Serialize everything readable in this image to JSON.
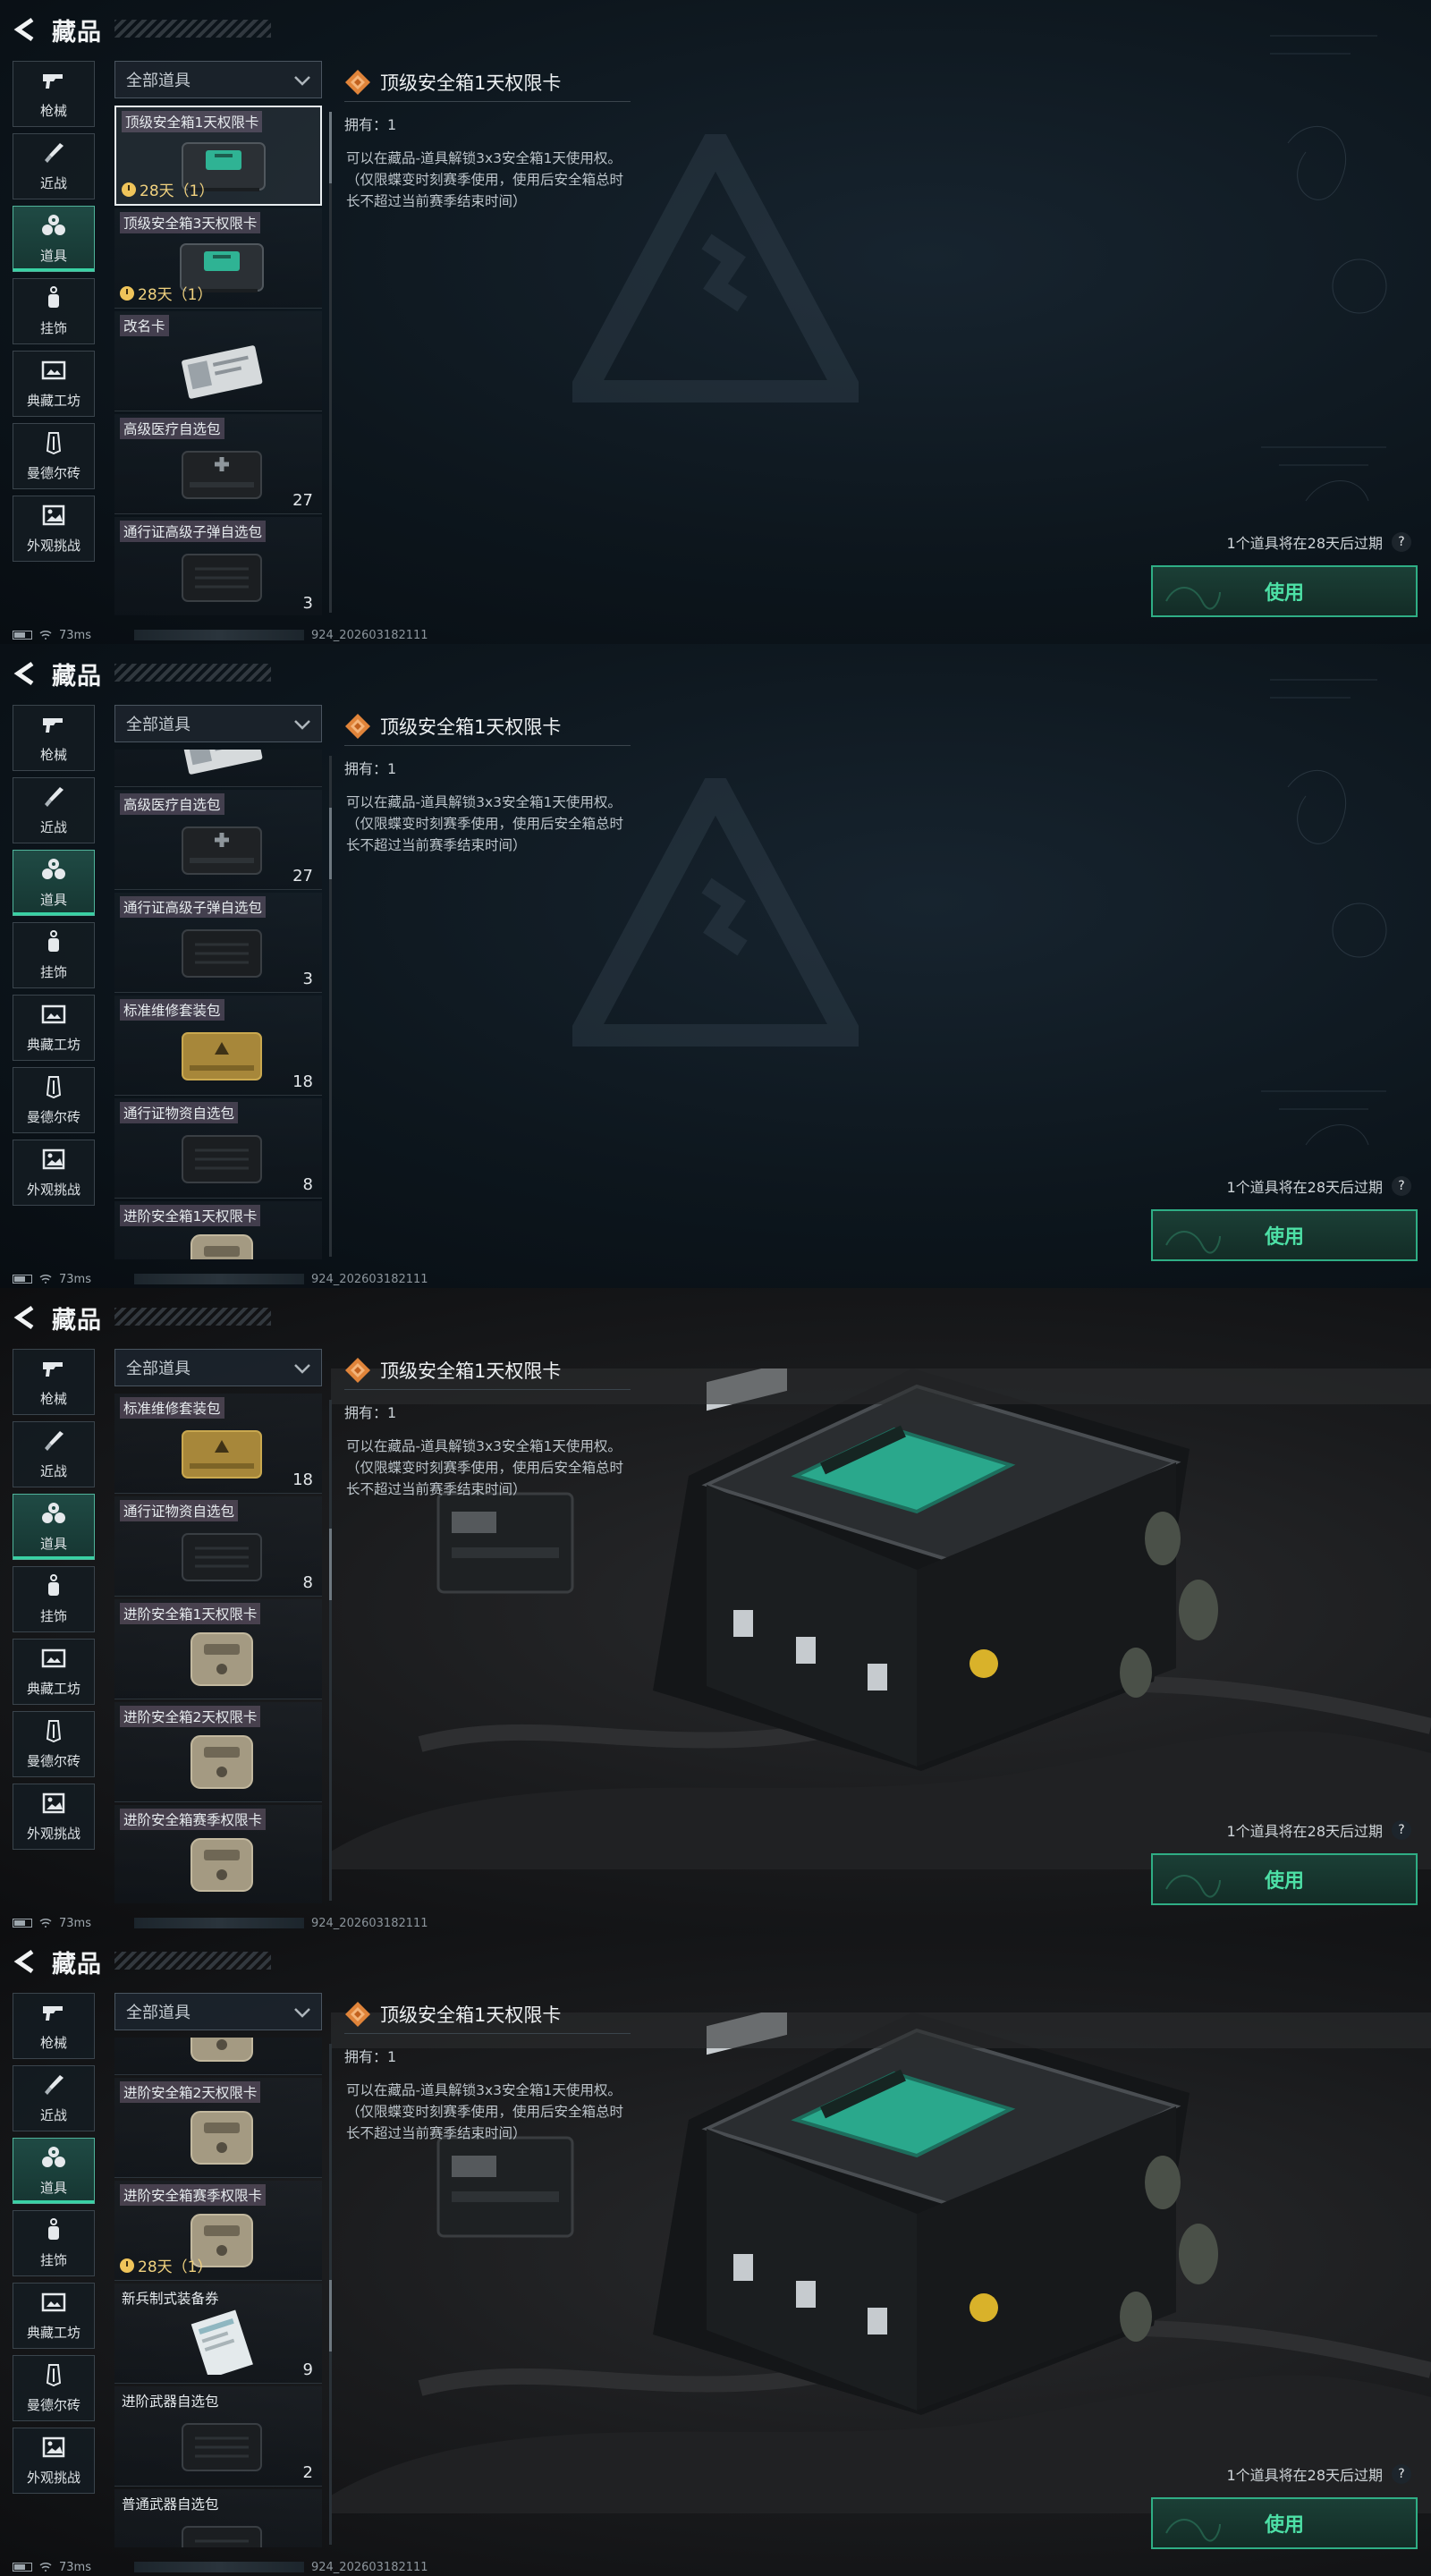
{
  "header": {
    "title": "藏品"
  },
  "nav": [
    {
      "label": "枪械",
      "icon": "gun-icon"
    },
    {
      "label": "近战",
      "icon": "knife-icon"
    },
    {
      "label": "道具",
      "icon": "items-icon",
      "active": true
    },
    {
      "label": "挂饰",
      "icon": "charm-icon"
    },
    {
      "label": "典藏工坊",
      "icon": "picture-frame-icon"
    },
    {
      "label": "曼德尔砖",
      "icon": "brick-icon"
    },
    {
      "label": "外观挑战",
      "icon": "image-icon"
    }
  ],
  "filter": {
    "label": "全部道具"
  },
  "detail": {
    "title": "顶级安全箱1天权限卡",
    "owned": "拥有：1",
    "description": "可以在藏品-道具解锁3x3安全箱1天使用权。（仅限蝶变时刻赛季使用，使用后安全箱总时长不超过当前赛季结束时间）"
  },
  "expire_note": "1个道具将在28天后过期",
  "help_label": "?",
  "use_button": "使用",
  "status": {
    "ping": "73ms",
    "uid": "924_202603182111"
  },
  "frames": [
    {
      "scene": "plain",
      "scroll": 0.0,
      "cards": [
        {
          "name": "顶级安全箱1天权限卡",
          "timer": "28天（1）",
          "selected": true,
          "pic": "teal"
        },
        {
          "name": "顶级安全箱3天权限卡",
          "timer": "28天（1）",
          "pic": "teal"
        },
        {
          "name": "改名卡",
          "pic": "card"
        },
        {
          "name": "高级医疗自选包",
          "count": "27",
          "pic": "med"
        },
        {
          "name": "通行证高级子弹自选包",
          "count": "3",
          "pic": "black"
        }
      ]
    },
    {
      "scene": "plain",
      "scroll": 0.12,
      "cards": [
        {
          "name": "",
          "pic": "card",
          "partial": true
        },
        {
          "name": "高级医疗自选包",
          "count": "27",
          "pic": "med"
        },
        {
          "name": "通行证高级子弹自选包",
          "count": "3",
          "pic": "black"
        },
        {
          "name": "标准维修套装包",
          "count": "18",
          "pic": "gold"
        },
        {
          "name": "通行证物资自选包",
          "count": "8",
          "pic": "black"
        },
        {
          "name": "进阶安全箱1天权限卡",
          "pic": "tan",
          "partial": true
        }
      ]
    },
    {
      "scene": "crate",
      "scroll": 0.3,
      "cards": [
        {
          "name": "标准维修套装包",
          "count": "18",
          "pic": "gold"
        },
        {
          "name": "通行证物资自选包",
          "count": "8",
          "pic": "black"
        },
        {
          "name": "进阶安全箱1天权限卡",
          "pic": "tan"
        },
        {
          "name": "进阶安全箱2天权限卡",
          "pic": "tan"
        },
        {
          "name": "进阶安全箱赛季权限卡",
          "pic": "tan"
        }
      ]
    },
    {
      "scene": "crate",
      "scroll": 0.55,
      "cards": [
        {
          "name": "",
          "pic": "tan",
          "partial": true
        },
        {
          "name": "进阶安全箱2天权限卡",
          "pic": "tan"
        },
        {
          "name": "进阶安全箱赛季权限卡",
          "timer": "28天（1）",
          "pic": "tan"
        },
        {
          "name": "新兵制式装备券",
          "count": "9",
          "pic": "paper",
          "plain": true
        },
        {
          "name": "进阶武器自选包",
          "count": "2",
          "pic": "black",
          "plain": true
        },
        {
          "name": "普通武器自选包",
          "pic": "black",
          "plain": true,
          "partial": true
        }
      ]
    }
  ]
}
